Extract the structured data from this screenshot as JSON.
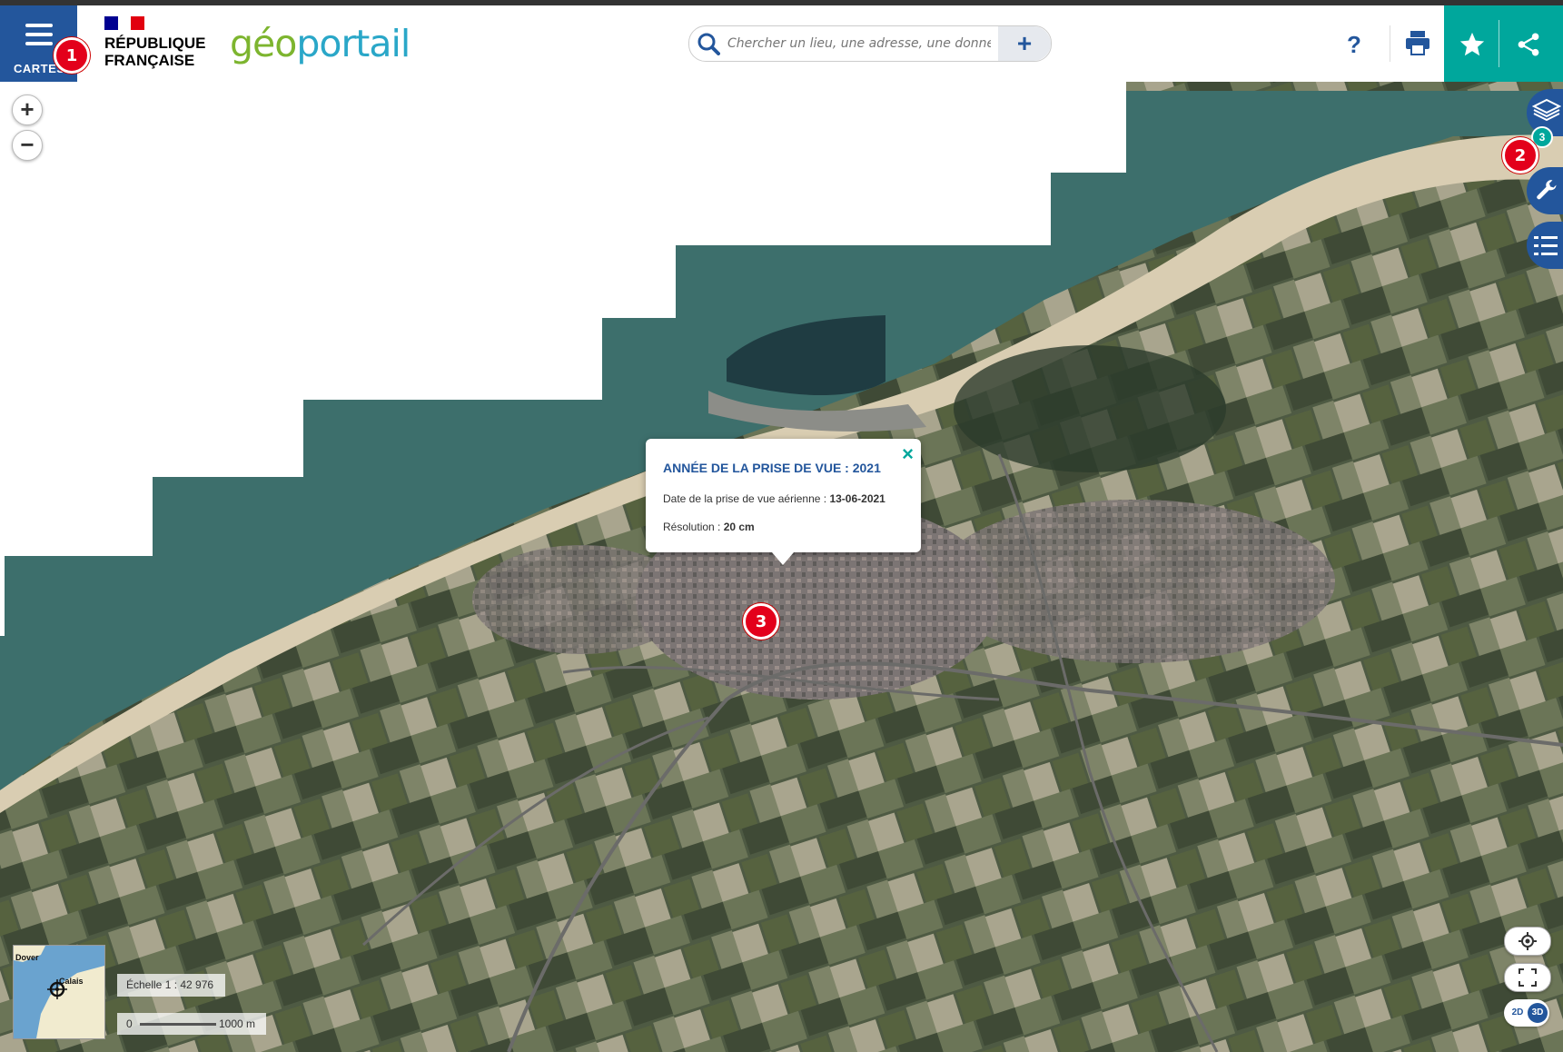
{
  "header": {
    "menu_label": "CARTES",
    "republique_line1": "RÉPUBLIQUE",
    "republique_line2": "FRANÇAISE",
    "logo_geo": "géo",
    "logo_portail": "portail",
    "search_placeholder": "Chercher un lieu, une adresse, une donnée",
    "search_plus": "+",
    "help": "?"
  },
  "badges": {
    "menu": "1",
    "tools": "2",
    "map": "3"
  },
  "layers": {
    "count": "3"
  },
  "zoom": {
    "in": "+",
    "out": "−"
  },
  "popup": {
    "title": "ANNÉE DE LA PRISE DE VUE : 2021",
    "date_label": "Date de la prise de vue aérienne : ",
    "date_value": "13-06-2021",
    "resolution_label": "Résolution : ",
    "resolution_value": "20 cm",
    "close": "×"
  },
  "minimap": {
    "label_dover": "Dover",
    "label_calais": "Calais"
  },
  "scale": {
    "ratio": "Échelle 1 : 42 976",
    "bar_start": "0",
    "bar_end": "1000 m"
  },
  "view_toggle": {
    "d2": "2D",
    "d3": "3D"
  },
  "colors": {
    "primary_blue": "#23569c",
    "teal": "#00a79c",
    "badge_red": "#e3001b",
    "geo_green": "#7db52f",
    "geo_orange": "#f39200",
    "geo_blue": "#2aa7c8"
  },
  "icons": [
    "menu-icon",
    "search-icon",
    "plus-icon",
    "help-icon",
    "print-icon",
    "star-icon",
    "share-icon",
    "layers-icon",
    "wrench-icon",
    "legend-icon",
    "close-icon",
    "locate-icon",
    "fullscreen-icon"
  ]
}
